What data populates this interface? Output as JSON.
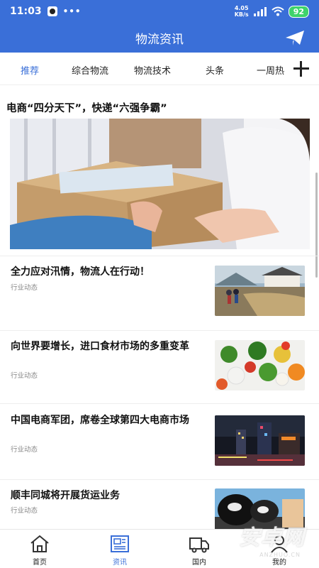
{
  "status": {
    "time": "11:03",
    "dots": "•••",
    "net_speed_value": "4.05",
    "net_speed_unit": "KB/s",
    "network": "5G",
    "battery": "92",
    "battery_color": "#3ed36b"
  },
  "header": {
    "title": "物流资讯",
    "bg_color": "#3a6fd8"
  },
  "tabs": [
    {
      "label": "推荐",
      "active": true
    },
    {
      "label": "综合物流",
      "active": false
    },
    {
      "label": "物流技术",
      "active": false
    },
    {
      "label": "头条",
      "active": false
    },
    {
      "label": "一周热",
      "active": false
    }
  ],
  "headline": {
    "title": "电商“四分天下”，快递“六强争霸”"
  },
  "news": [
    {
      "title": "全力应对汛情，物流人在行动！",
      "tag": "行业动态"
    },
    {
      "title": "向世界要增长，进口食材市场的多重变革",
      "tag": "行业动态"
    },
    {
      "title": "中国电商军团，席卷全球第四大电商市场",
      "tag": "行业动态"
    },
    {
      "title": "顺丰同城将开展货运业务",
      "tag": "行业动态"
    }
  ],
  "bottom_nav": [
    {
      "label": "首页",
      "icon": "home-icon",
      "active": false
    },
    {
      "label": "资讯",
      "icon": "news-icon",
      "active": true
    },
    {
      "label": "国内",
      "icon": "truck-icon",
      "active": false
    },
    {
      "label": "我的",
      "icon": "user-icon",
      "active": false
    }
  ],
  "watermark": {
    "text": "安卓网",
    "sub": "ANZHUO.CN"
  }
}
